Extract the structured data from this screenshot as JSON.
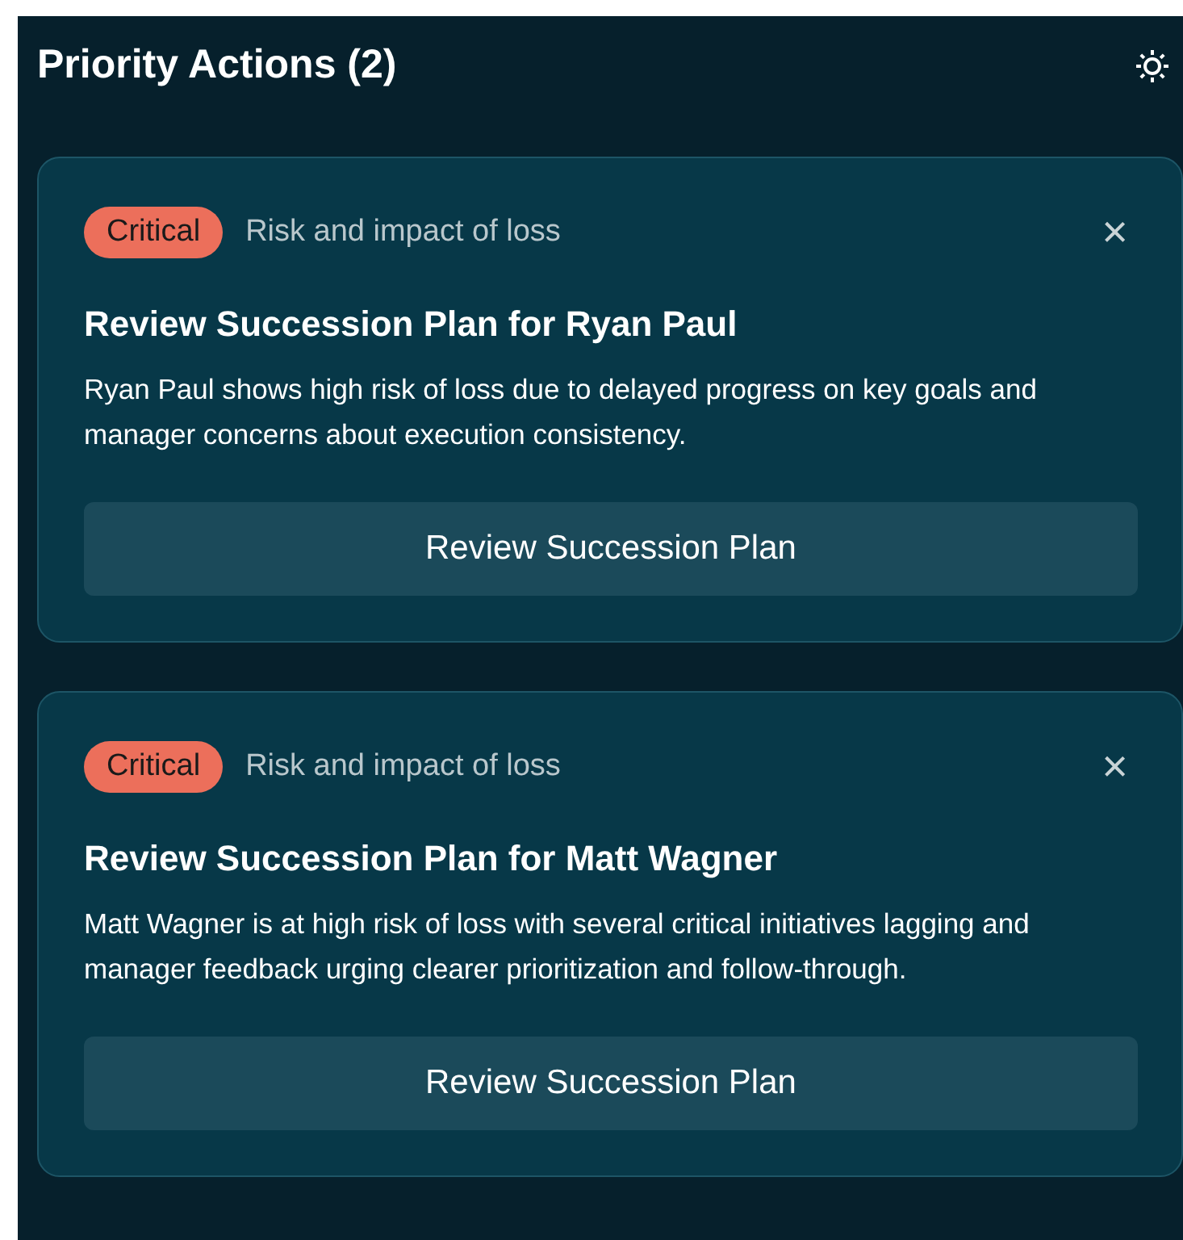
{
  "header": {
    "title": "Priority Actions (2)"
  },
  "actions": [
    {
      "badge": {
        "label": "Critical",
        "color": "#ec6f5b"
      },
      "category": "Risk and impact of loss",
      "close": "×",
      "title": "Review Succession Plan for Ryan Paul",
      "description": "Ryan Paul shows high risk of loss due to delayed progress on key goals and manager concerns about execution consistency.",
      "button": "Review Succession Plan"
    },
    {
      "badge": {
        "label": "Critical",
        "color": "#ec6f5b"
      },
      "category": "Risk and impact of loss",
      "close": "×",
      "title": "Review Succession Plan for Matt Wagner",
      "description": "Matt Wagner is at high risk of loss with several critical initiatives lagging and manager feedback urging clearer prioritization and follow-through.",
      "button": "Review Succession Plan"
    }
  ]
}
